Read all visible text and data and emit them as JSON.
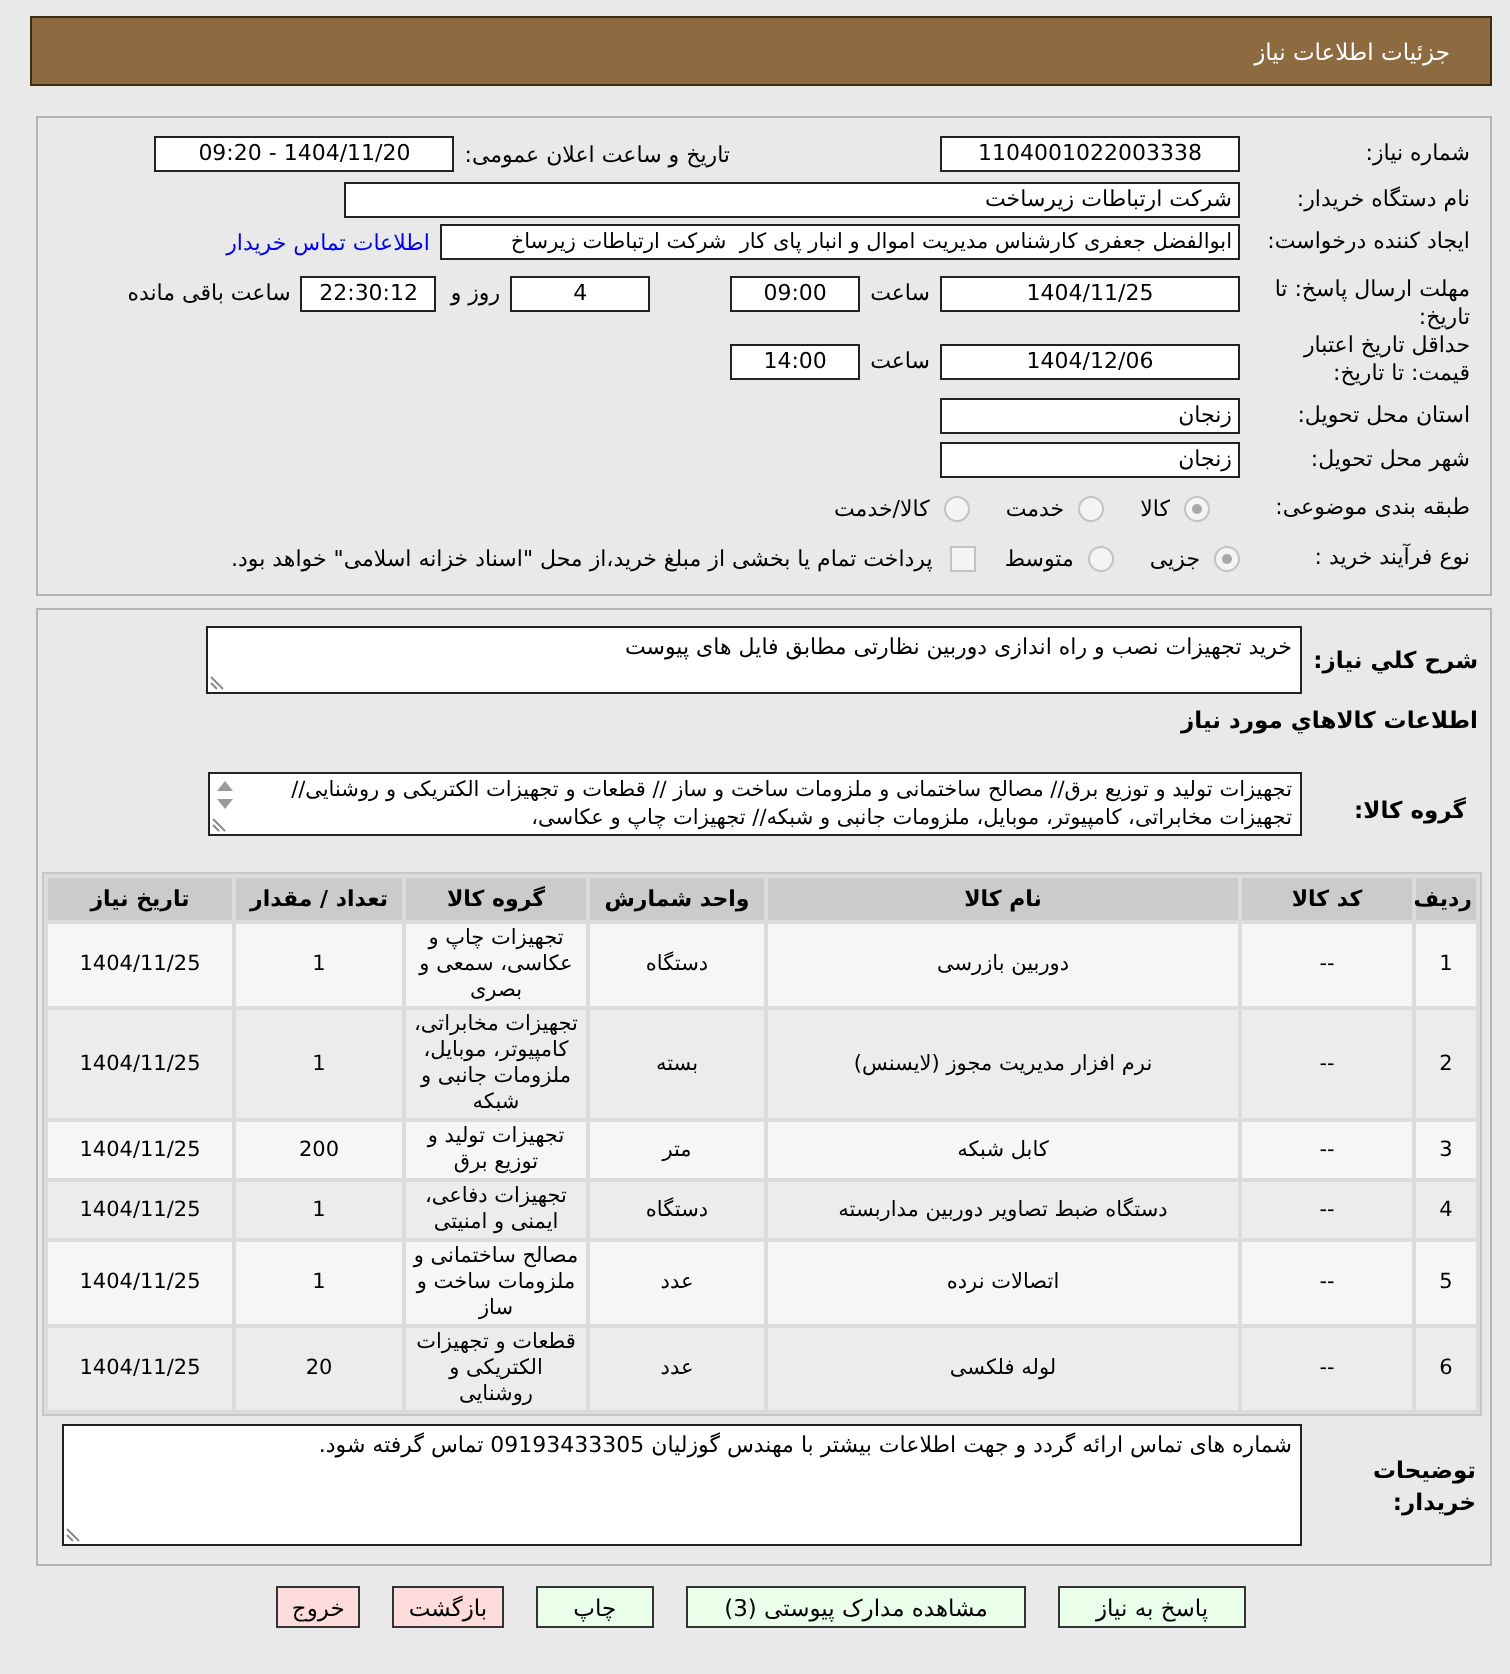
{
  "header": {
    "title": "جزئیات اطلاعات نیاز"
  },
  "details": {
    "need_number": {
      "label": "شماره نیاز:",
      "value": "1104001022003338"
    },
    "announce_datetime": {
      "label": "تاریخ و ساعت اعلان عمومی:",
      "value": "1404/11/20 - 09:20"
    },
    "buyer_org": {
      "label": "نام دستگاه خریدار:",
      "value": "شرکت ارتباطات زیرساخت"
    },
    "requester": {
      "label": "ایجاد کننده درخواست:",
      "value": "ابوالفضل جعفری کارشناس مدیریت اموال و انبار پای کار  شرکت ارتباطات زیرساخ",
      "link": "اطلاعات تماس خریدار"
    },
    "response_deadline": {
      "label": "مهلت ارسال پاسخ: تا تاریخ:",
      "date": "1404/11/25",
      "time_label": "ساعت",
      "time": "09:00",
      "days": "4",
      "days_label": "روز و",
      "remaining": "22:30:12",
      "remaining_label": "ساعت باقی مانده"
    },
    "price_validity": {
      "label": "حداقل تاریخ اعتبار قیمت: تا تاریخ:",
      "date": "1404/12/06",
      "time_label": "ساعت",
      "time": "14:00"
    },
    "province": {
      "label": "استان محل تحویل:",
      "value": "زنجان"
    },
    "city": {
      "label": "شهر محل تحویل:",
      "value": "زنجان"
    },
    "category": {
      "label": "طبقه بندی موضوعی:",
      "disabled": true,
      "options": [
        {
          "label": "کالا",
          "selected": true
        },
        {
          "label": "خدمت",
          "selected": false
        },
        {
          "label": "کالا/خدمت",
          "selected": false
        }
      ]
    },
    "purchase_process": {
      "label": "نوع فرآیند خرید :",
      "disabled": true,
      "options": [
        {
          "label": "جزیی",
          "selected": true
        },
        {
          "label": "متوسط",
          "selected": false
        }
      ],
      "treasury_payment": {
        "label": "پرداخت تمام یا بخشی از مبلغ خرید،از محل \"اسناد خزانه اسلامی\" خواهد بود.",
        "checked": false
      }
    }
  },
  "need": {
    "description": {
      "label": "شرح کلي نياز:",
      "value": "خرید تجهیزات نصب و راه اندازی دوربین نظارتی مطابق فایل های پیوست"
    },
    "items_heading": "اطلاعات کالاهاي مورد نياز",
    "goods_group": {
      "label": "گروه کالا:",
      "value": "تجهیزات تولید و توزیع برق// مصالح ساختمانی و ملزومات ساخت و ساز // قطعات و تجهیزات الکتریکی و روشنایی// تجهیزات مخابراتی، کامپیوتر، موبایل، ملزومات جانبی و شبکه// تجهیزات چاپ و عکاسی،"
    },
    "table": {
      "columns": [
        "ردیف",
        "کد کالا",
        "نام کالا",
        "واحد شمارش",
        "گروه کالا",
        "تعداد / مقدار",
        "تاریخ نیاز"
      ],
      "rows": [
        [
          "1",
          "--",
          "دوربین بازرسی",
          "دستگاه",
          "تجهیزات چاپ و عکاسی، سمعی و بصری",
          "1",
          "1404/11/25"
        ],
        [
          "2",
          "--",
          "نرم افزار مدیریت مجوز (لایسنس)",
          "بسته",
          "تجهیزات مخابراتی، کامپیوتر، موبایل، ملزومات جانبی و شبکه",
          "1",
          "1404/11/25"
        ],
        [
          "3",
          "--",
          "کابل شبکه",
          "متر",
          "تجهیزات تولید و توزیع برق",
          "200",
          "1404/11/25"
        ],
        [
          "4",
          "--",
          "دستگاه ضبط تصاویر دوربین مداربسته",
          "دستگاه",
          "تجهیزات دفاعی، ایمنی و امنیتی",
          "1",
          "1404/11/25"
        ],
        [
          "5",
          "--",
          "اتصالات نرده",
          "عدد",
          "مصالح ساختمانی و ملزومات ساخت و ساز",
          "1",
          "1404/11/25"
        ],
        [
          "6",
          "--",
          "لوله فلکسی",
          "عدد",
          "قطعات و تجهیزات الکتریکی و روشنایی",
          "20",
          "1404/11/25"
        ]
      ]
    },
    "buyer_notes": {
      "label": "توضیحات خریدار:",
      "value": "شماره های تماس ارائه گردد و جهت اطلاعات بیشتر با مهندس گوزلیان 09193433305 تماس گرفته شود."
    }
  },
  "buttons": [
    {
      "label": "پاسخ به نیاز",
      "kind": "action"
    },
    {
      "label": "مشاهده مدارک پیوستی (3)",
      "kind": "action"
    },
    {
      "label": "چاپ",
      "kind": "action"
    },
    {
      "label": "بازگشت",
      "kind": "cancel"
    },
    {
      "label": "خروج",
      "kind": "cancel"
    }
  ]
}
